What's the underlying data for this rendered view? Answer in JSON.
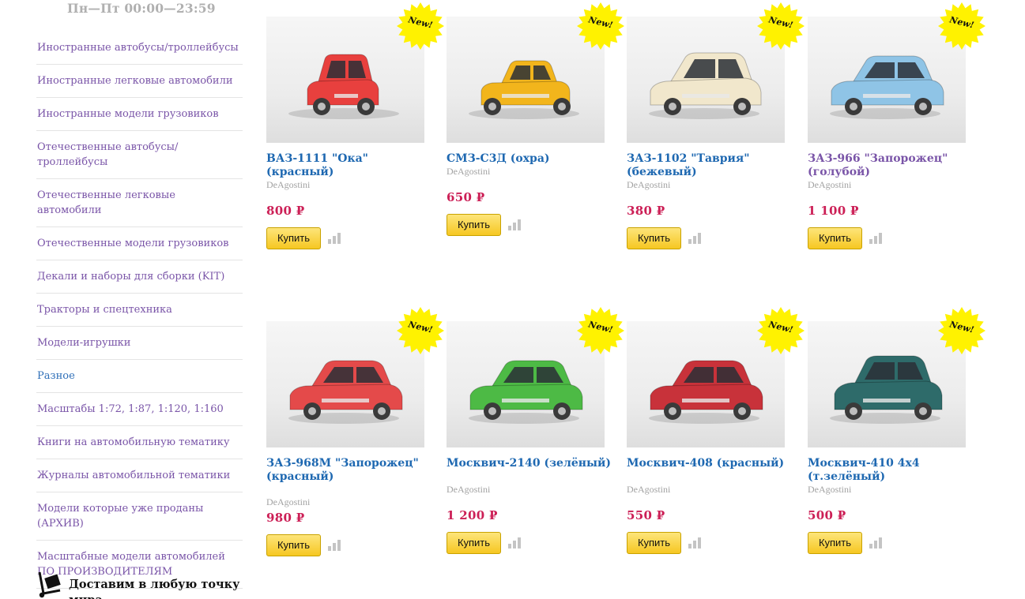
{
  "header": {
    "hours": "Пн—Пт 00:00—23:59"
  },
  "sidebar": {
    "items": [
      {
        "label": "Иностранные автобусы/троллейбусы"
      },
      {
        "label": "Иностранные легковые автомобили"
      },
      {
        "label": "Иностранные модели грузовиков"
      },
      {
        "label": "Отечественные автобусы/троллейбусы"
      },
      {
        "label": "Отечественные легковые автомобили"
      },
      {
        "label": "Отечественные модели грузовиков"
      },
      {
        "label": "Декали и наборы для сборки (KIT)"
      },
      {
        "label": "Тракторы и спецтехника"
      },
      {
        "label": "Модели-игрушки"
      },
      {
        "label": "Разное"
      },
      {
        "label": "Масштабы 1:72, 1:87, 1:120, 1:160"
      },
      {
        "label": "Книги на автомобильную тематику"
      },
      {
        "label": "Журналы автомобильной тематики"
      },
      {
        "label": "Модели которые уже проданы (АРХИВ)"
      },
      {
        "label": "Масштабные модели автомобилей ПО ПРОИЗВОДИТЕЛЯМ"
      }
    ],
    "delivery_text": "Доставим в любую точку мира",
    "delivery_icon": "cart-icon"
  },
  "colors": {
    "link": "#1e68b1",
    "visited": "#7a55a8",
    "price": "#cc1f56",
    "button": "#f6c722",
    "badge": "#fff200"
  },
  "products": [
    {
      "title": "ВАЗ-1111 \"Ока\" (красный)",
      "brand": "DeAgostini",
      "price": "800 ₽",
      "buy_label": "Купить",
      "badge": "New!",
      "car_color": "#e8403e",
      "car_shape": "hatch-small"
    },
    {
      "title": "СМЗ-С3Д (охра)",
      "brand": "DeAgostini",
      "price": "650 ₽",
      "buy_label": "Купить",
      "badge": "New!",
      "car_color": "#f2b51c",
      "car_shape": "coupe-small"
    },
    {
      "title": "ЗАЗ-1102 \"Таврия\" (бежевый)",
      "brand": "DeAgostini",
      "price": "380 ₽",
      "buy_label": "Купить",
      "badge": "New!",
      "car_color": "#f1e7cc",
      "car_shape": "hatch"
    },
    {
      "title": "ЗАЗ-966 \"Запорожец\" (голубой)",
      "brand": "DeAgostini",
      "price": "1 100 ₽",
      "buy_label": "Купить",
      "badge": "New!",
      "car_color": "#8fc4e6",
      "car_shape": "sedan"
    },
    {
      "title": "ЗАЗ-968М \"Запорожец\" (красный)",
      "brand": "DeAgostini",
      "price": "980 ₽",
      "buy_label": "Купить",
      "badge": "New!",
      "car_color": "#e44a4a",
      "car_shape": "sedan"
    },
    {
      "title": "Москвич-2140 (зелёный)",
      "brand": "DeAgostini",
      "price": "1 200 ₽",
      "buy_label": "Купить",
      "badge": "New!",
      "car_color": "#4dba45",
      "car_shape": "sedan"
    },
    {
      "title": "Москвич-408 (красный)",
      "brand": "DeAgostini",
      "price": "550 ₽",
      "buy_label": "Купить",
      "badge": "New!",
      "car_color": "#c8323a",
      "car_shape": "sedan"
    },
    {
      "title": "Москвич-410 4x4 (т.зелёный)",
      "brand": "DeAgostini",
      "price": "500 ₽",
      "buy_label": "Купить",
      "badge": "New!",
      "car_color": "#2e6b6a",
      "car_shape": "sedan-old"
    }
  ]
}
